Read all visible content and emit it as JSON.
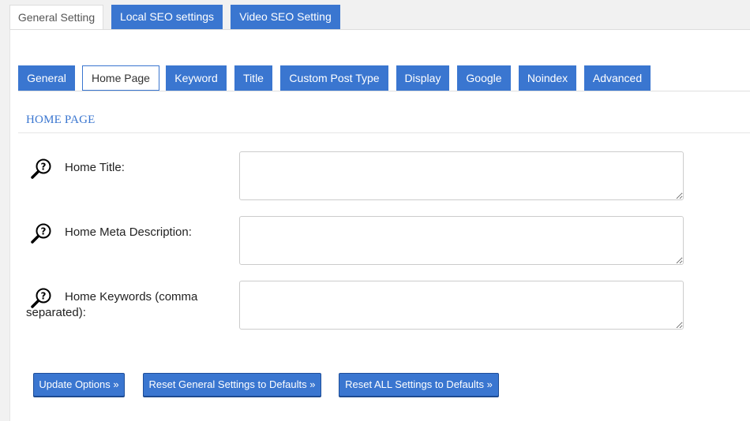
{
  "top_tabs": [
    {
      "label": "General Setting",
      "active": true
    },
    {
      "label": "Local SEO settings",
      "active": false
    },
    {
      "label": "Video SEO Setting",
      "active": false
    }
  ],
  "sub_tabs": [
    {
      "label": "General",
      "active": false
    },
    {
      "label": "Home Page",
      "active": true
    },
    {
      "label": "Keyword",
      "active": false
    },
    {
      "label": "Title",
      "active": false
    },
    {
      "label": "Custom Post Type",
      "active": false
    },
    {
      "label": "Display",
      "active": false
    },
    {
      "label": "Google",
      "active": false
    },
    {
      "label": "Noindex",
      "active": false
    },
    {
      "label": "Advanced",
      "active": false
    }
  ],
  "section": {
    "title": "HOME PAGE"
  },
  "fields": [
    {
      "label": "Home Title:",
      "value": "",
      "icon": "help-magnifier-icon"
    },
    {
      "label": "Home Meta Description:",
      "value": "",
      "icon": "help-magnifier-icon"
    },
    {
      "label": "Home Keywords (comma separated):",
      "value": "",
      "icon": "help-magnifier-icon"
    }
  ],
  "buttons": {
    "update": "Update Options »",
    "reset_general": "Reset General Settings to Defaults »",
    "reset_all": "Reset ALL Settings to Defaults »"
  },
  "colors": {
    "accent": "#3a76d0",
    "background": "#f1f1f1",
    "panel": "#ffffff"
  }
}
